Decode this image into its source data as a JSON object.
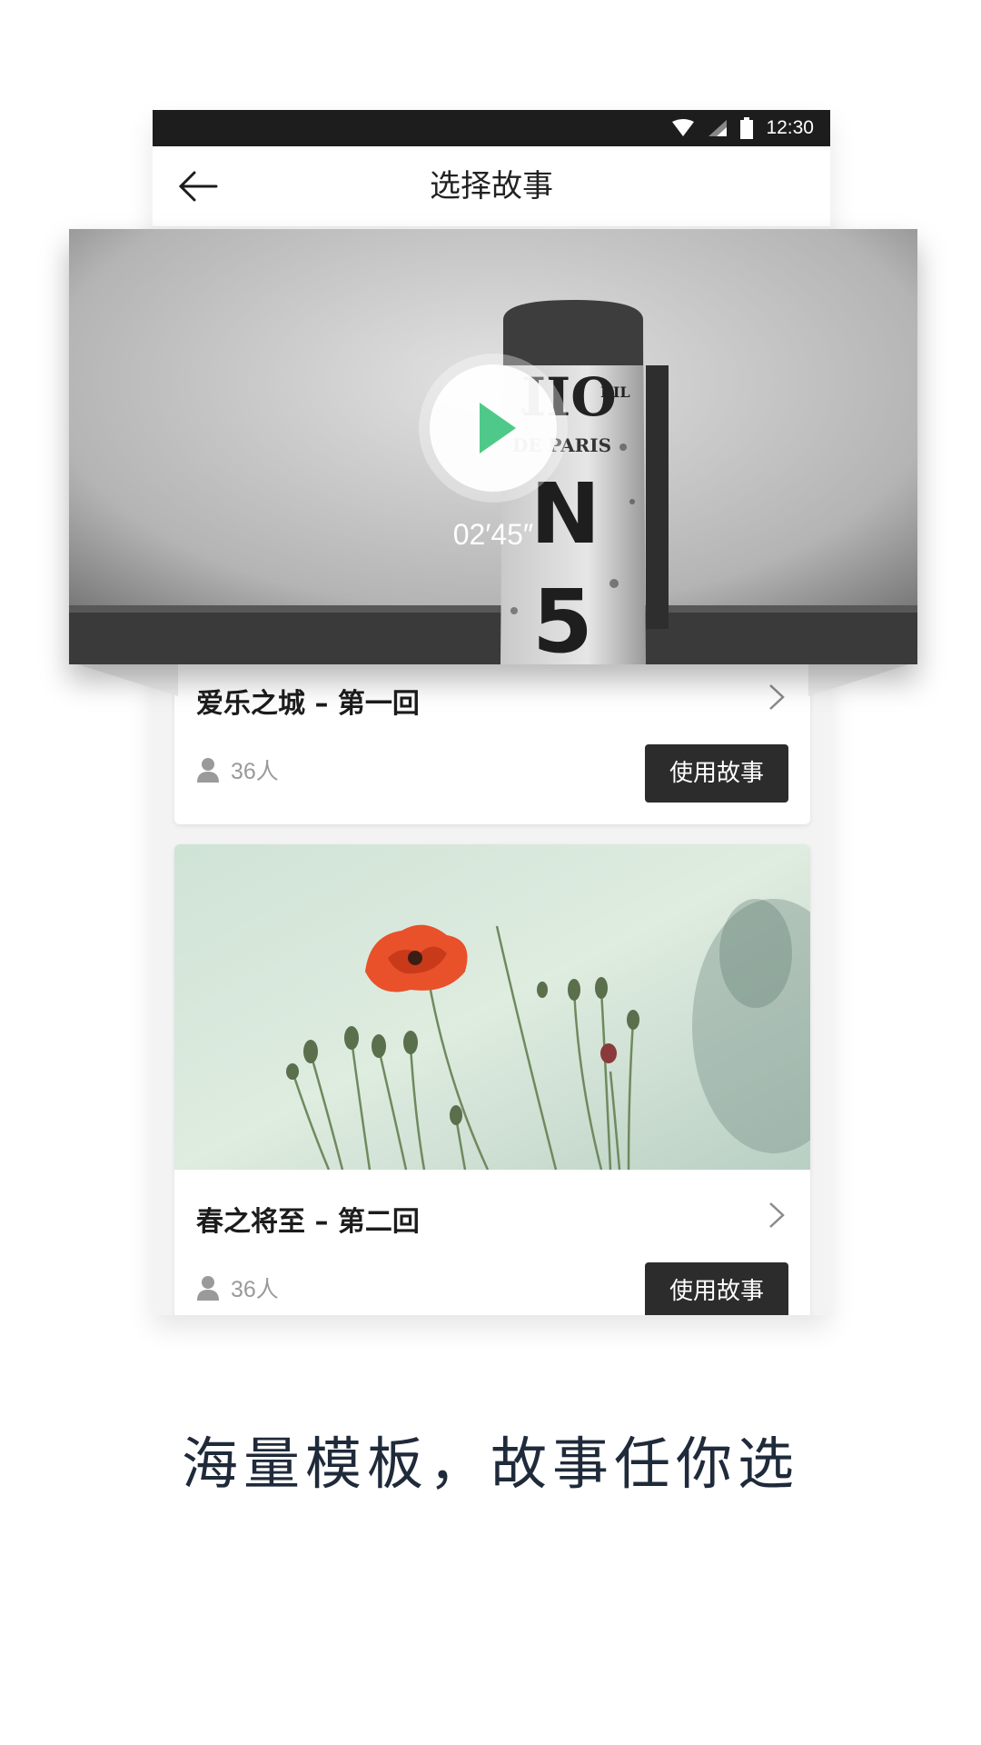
{
  "status_bar": {
    "time": "12:30",
    "icons": [
      "wifi-icon",
      "signal-icon",
      "battery-icon"
    ]
  },
  "app_bar": {
    "title": "选择故事",
    "back_icon": "arrow-left-icon"
  },
  "stories": [
    {
      "title": "爱乐之城 – 第一回",
      "count": "36人",
      "button": "使用故事",
      "duration": "02′45″",
      "image_text": [
        "IIO",
        "KIL",
        "DE PARIS",
        "N",
        "5"
      ]
    },
    {
      "title": "春之将至 – 第二回",
      "count": "36人",
      "button": "使用故事"
    }
  ],
  "tagline": "海量模板，故事任你选",
  "colors": {
    "button_bg": "#2c2c2c",
    "play_accent": "#4fc98a",
    "status_bar": "#1d1d1d",
    "poppy": "#e8512a"
  }
}
